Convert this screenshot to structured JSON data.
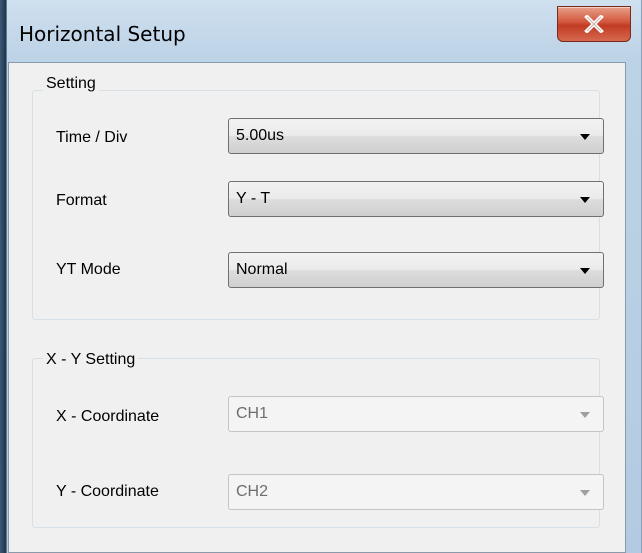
{
  "window": {
    "title": "Horizontal Setup",
    "close_icon": "close-icon"
  },
  "setting": {
    "group_label": "Setting",
    "time_div": {
      "label": "Time / Div",
      "value": "5.00us"
    },
    "format": {
      "label": "Format",
      "value": "Y - T"
    },
    "yt_mode": {
      "label": "YT Mode",
      "value": "Normal"
    }
  },
  "xy_setting": {
    "group_label": "X - Y Setting",
    "x_coordinate": {
      "label": "X - Coordinate",
      "value": "CH1",
      "enabled": false
    },
    "y_coordinate": {
      "label": "Y - Coordinate",
      "value": "CH2",
      "enabled": false
    }
  },
  "colors": {
    "close_button": "#c9402a",
    "dialog_bg": "#f0f0f0",
    "frame": "#b9d1ea"
  }
}
